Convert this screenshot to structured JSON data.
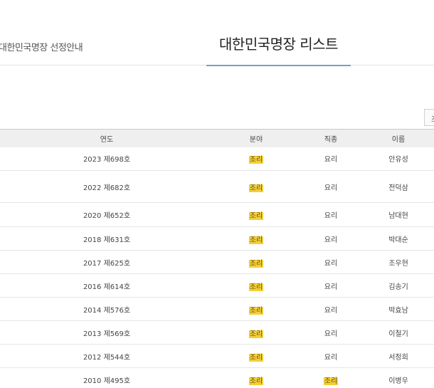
{
  "tabs": {
    "guide_label": "대한민국명장 선정안내",
    "list_label": "대한민국명장 리스트"
  },
  "search_button_label": "조",
  "table": {
    "headers": [
      "연도",
      "분야",
      "직종",
      "이름"
    ],
    "rows": [
      {
        "year": "2023 제698호",
        "field": "조리",
        "job": "요리",
        "name": "안유성",
        "job_hl": false
      },
      {
        "year": "2022 제682호",
        "field": "조리",
        "job": "요리",
        "name": "전덕삼",
        "job_hl": false
      },
      {
        "year": "2020 제652호",
        "field": "조리",
        "job": "요리",
        "name": "남대현",
        "job_hl": false
      },
      {
        "year": "2018 제631호",
        "field": "조리",
        "job": "요리",
        "name": "박대순",
        "job_hl": false
      },
      {
        "year": "2017 제625호",
        "field": "조리",
        "job": "요리",
        "name": "조우현",
        "job_hl": false
      },
      {
        "year": "2016 제614호",
        "field": "조리",
        "job": "요리",
        "name": "김송기",
        "job_hl": false
      },
      {
        "year": "2014 제576호",
        "field": "조리",
        "job": "요리",
        "name": "박효남",
        "job_hl": false
      },
      {
        "year": "2013 제569호",
        "field": "조리",
        "job": "요리",
        "name": "이철기",
        "job_hl": false
      },
      {
        "year": "2012 제544호",
        "field": "조리",
        "job": "요리",
        "name": "서정희",
        "job_hl": false
      },
      {
        "year": "2010 제495호",
        "field": "조리",
        "job": "조리",
        "name": "이병우",
        "job_hl": true
      }
    ]
  },
  "colors": {
    "highlight": "#f2cf3a",
    "tab_underline": "#7a9fc4",
    "header_bg": "#efefef"
  }
}
